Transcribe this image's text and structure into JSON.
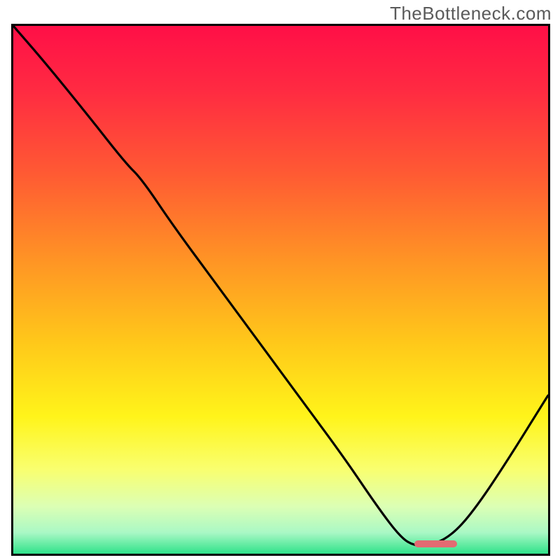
{
  "watermark": "TheBottleneck.com",
  "chart_data": {
    "type": "line",
    "title": "",
    "xlabel": "",
    "ylabel": "",
    "x_range": [
      0,
      100
    ],
    "y_range": [
      0,
      100
    ],
    "grid": false,
    "legend": false,
    "background_gradient_stops": [
      {
        "pos": 0.0,
        "color": "#ff0f47"
      },
      {
        "pos": 0.12,
        "color": "#ff2a42"
      },
      {
        "pos": 0.28,
        "color": "#ff5a33"
      },
      {
        "pos": 0.45,
        "color": "#ff9624"
      },
      {
        "pos": 0.6,
        "color": "#ffc81a"
      },
      {
        "pos": 0.74,
        "color": "#fff41a"
      },
      {
        "pos": 0.84,
        "color": "#f9ff6f"
      },
      {
        "pos": 0.91,
        "color": "#dcffb4"
      },
      {
        "pos": 0.96,
        "color": "#aaf8c5"
      },
      {
        "pos": 1.0,
        "color": "#2fe28a"
      }
    ],
    "series": [
      {
        "name": "bottleneck-curve",
        "x": [
          0,
          6,
          14,
          21,
          24,
          30,
          38,
          46,
          54,
          62,
          68,
          72.5,
          75,
          78,
          82,
          86,
          92,
          100
        ],
        "y": [
          100,
          93,
          83,
          74,
          71,
          62,
          51,
          40,
          29,
          18,
          9,
          3,
          1.5,
          1.5,
          3.5,
          8,
          17,
          30
        ],
        "note": "y is percent of plot height from bottom; curve dips to a minimum near x≈75–78 and rises again"
      }
    ],
    "marker": {
      "name": "optimal-zone-pill",
      "x_start": 75,
      "x_end": 83,
      "y": 1.8,
      "color": "#e36a72"
    }
  }
}
